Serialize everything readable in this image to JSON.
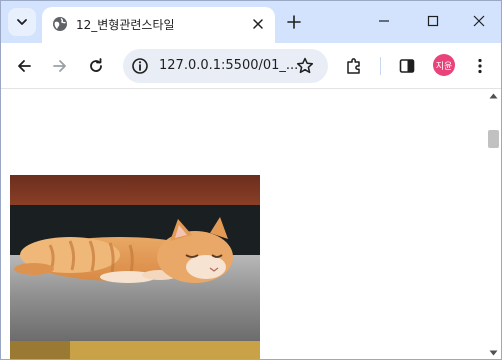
{
  "tab": {
    "title": "12_변형관련스타일",
    "favicon_icon": "globe-icon",
    "close_icon": "close-icon"
  },
  "window": {
    "tab_search_icon": "chevron-down-icon",
    "new_tab_icon": "plus-icon",
    "minimize_icon": "minimize-icon",
    "maximize_icon": "maximize-icon",
    "close_icon": "close-icon"
  },
  "toolbar": {
    "back_icon": "back-arrow-icon",
    "forward_icon": "forward-arrow-icon",
    "reload_icon": "reload-icon",
    "site_info_icon": "info-icon",
    "url": "127.0.0.1:5500/01_...",
    "bookmark_icon": "star-icon",
    "extensions_icon": "puzzle-icon",
    "side_panel_icon": "side-panel-icon",
    "profile_name": "지윤",
    "menu_icon": "kebab-menu-icon"
  },
  "page": {
    "image_subject": "sleeping kitten photo"
  },
  "colors": {
    "tabstrip_bg": "#d3e3fd",
    "omnibox_bg": "#e9eef6",
    "avatar_bg": "#e8437a"
  }
}
